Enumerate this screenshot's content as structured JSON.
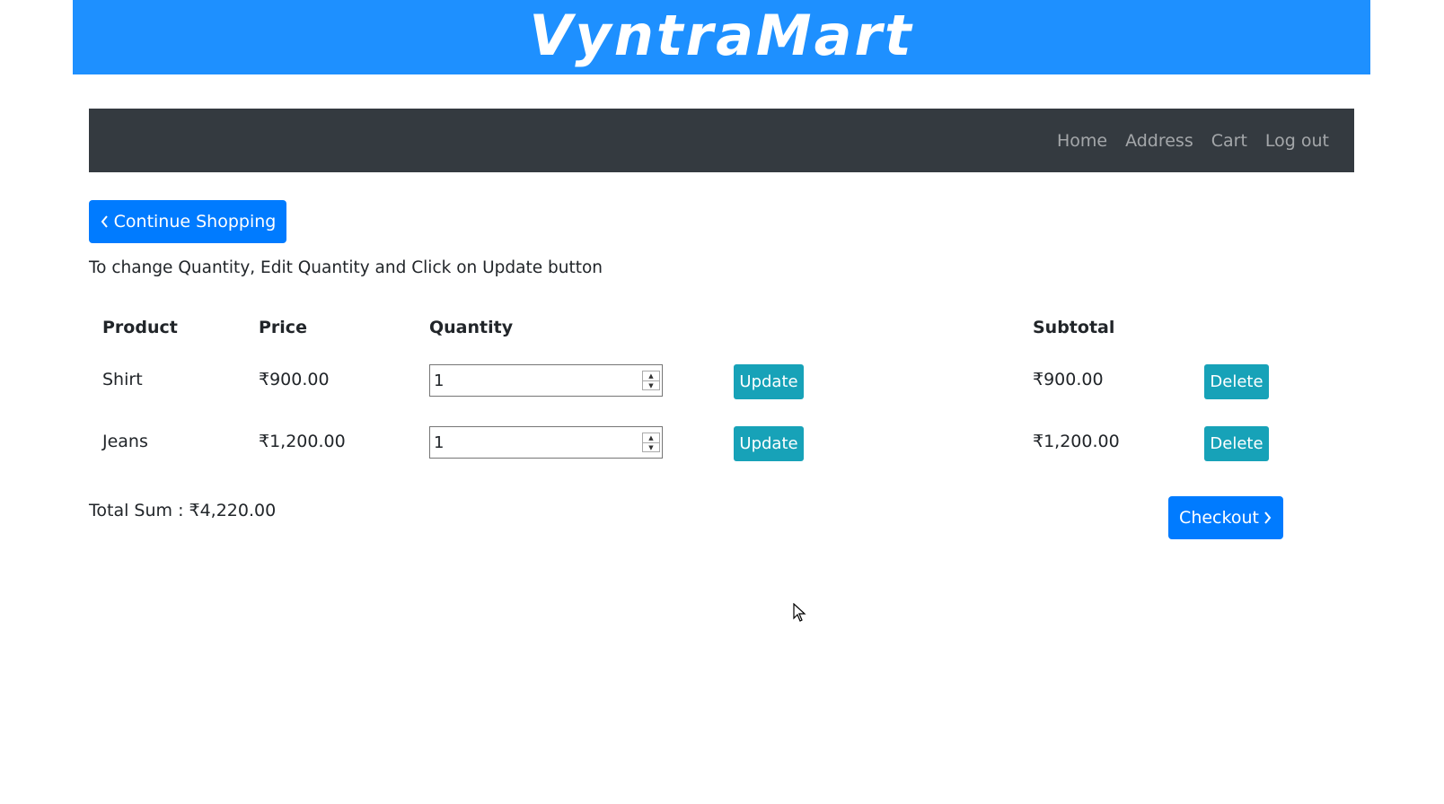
{
  "brand": {
    "title": "VyntraMart",
    "color": "#1e90ff"
  },
  "nav": {
    "items": [
      {
        "label": "Home"
      },
      {
        "label": "Address"
      },
      {
        "label": "Cart"
      },
      {
        "label": "Log out"
      }
    ]
  },
  "continue_button": {
    "label": "Continue Shopping",
    "icon": "chevron-left-icon"
  },
  "instructions": "To change Quantity, Edit Quantity and Click on Update button",
  "table": {
    "headers": {
      "product": "Product",
      "price": "Price",
      "quantity": "Quantity",
      "subtotal": "Subtotal"
    },
    "rows": [
      {
        "product": "Shirt",
        "price": "₹900.00",
        "quantity": "1",
        "update_label": "Update",
        "subtotal": "₹900.00",
        "delete_label": "Delete"
      },
      {
        "product": "Jeans",
        "price": "₹1,200.00",
        "quantity": "1",
        "update_label": "Update",
        "subtotal": "₹1,200.00",
        "delete_label": "Delete"
      }
    ]
  },
  "total": {
    "text": "Total Sum : ₹4,220.00"
  },
  "checkout_button": {
    "label": "Checkout",
    "icon": "chevron-right-icon"
  },
  "colors": {
    "primary": "#007bff",
    "info": "#17a2b8",
    "navbar": "#343a40"
  }
}
